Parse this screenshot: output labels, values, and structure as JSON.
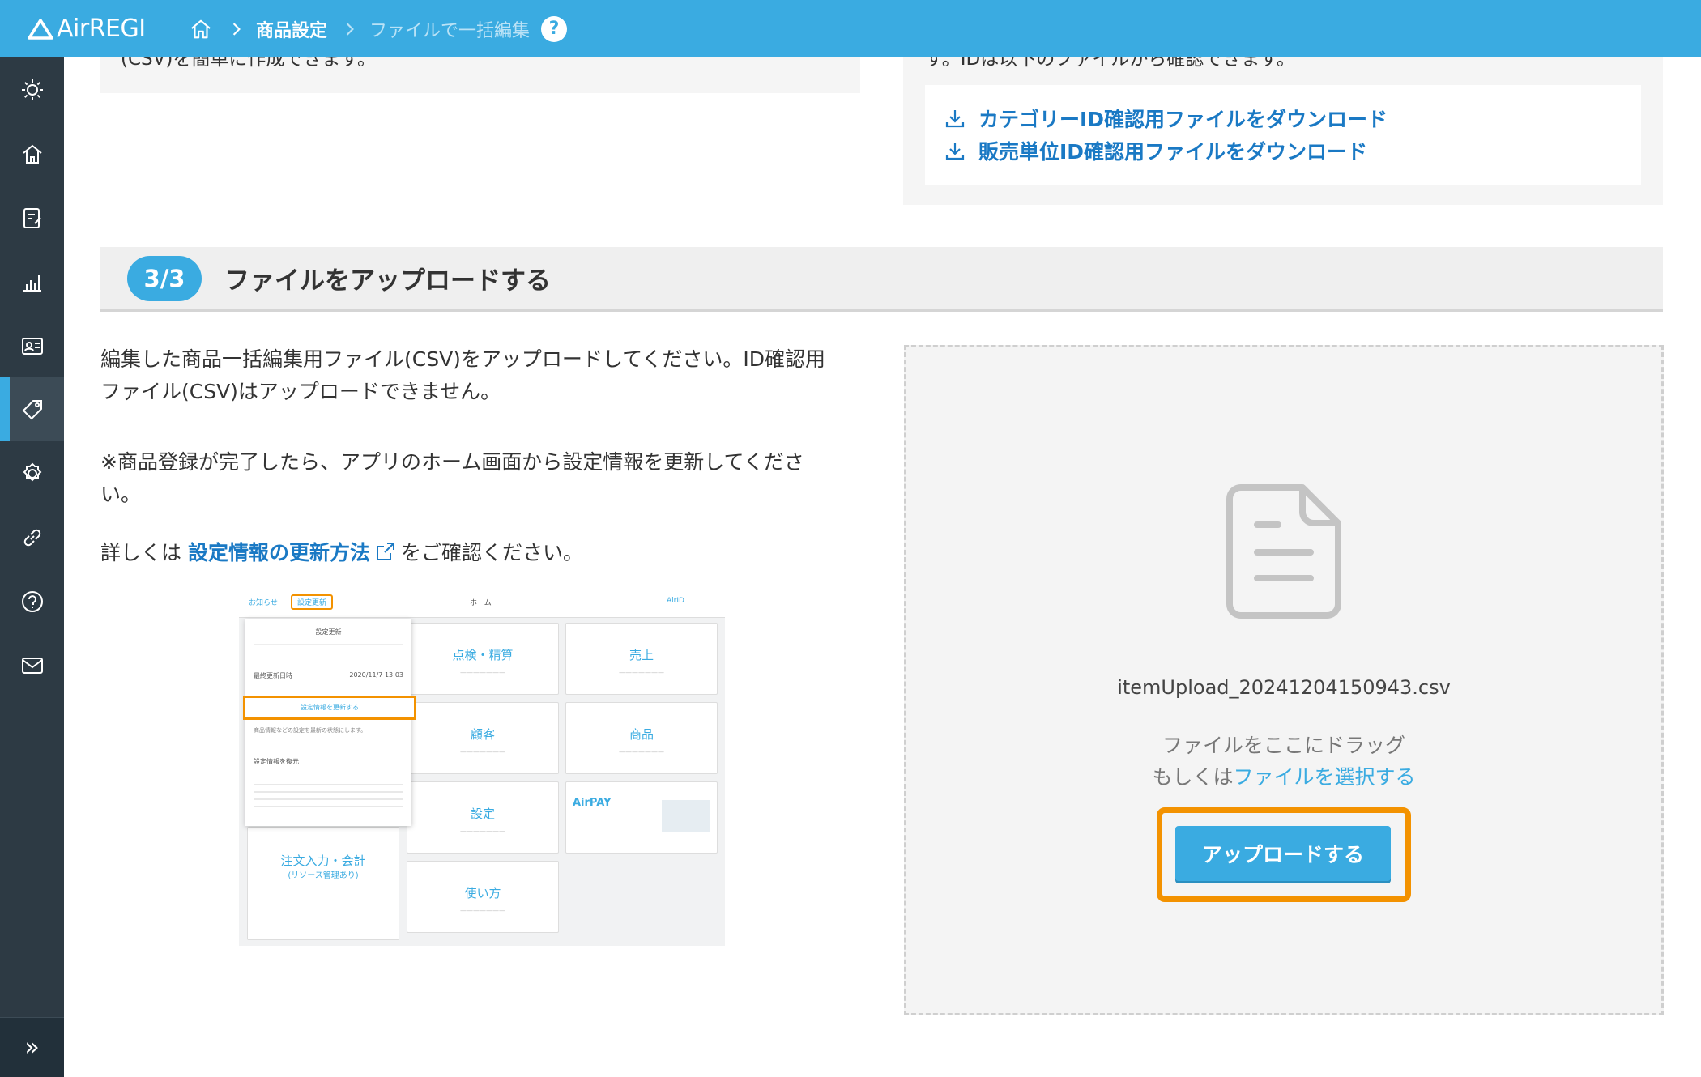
{
  "header": {
    "logo_text": "AirREGI",
    "breadcrumb_link": "商品設定",
    "breadcrumb_current": "ファイルで一括編集",
    "help_glyph": "?"
  },
  "sidebar": {
    "items": [
      "sun-icon",
      "home-icon",
      "order-icon",
      "chart-icon",
      "customer-icon",
      "tag-icon",
      "settings-icon",
      "link-icon",
      "help-icon",
      "mail-icon"
    ],
    "active_index": 5,
    "expand_glyph": "»"
  },
  "prev_section": {
    "left_cut_text": "(CSV)を簡単に作成できます。",
    "right_cut_text": "す。IDは以下のファイルから確認できます。",
    "download_links": [
      "カテゴリーID確認用ファイルをダウンロード",
      "販売単位ID確認用ファイルをダウンロード"
    ]
  },
  "section": {
    "step": "3/3",
    "title": "ファイルをアップロードする",
    "para1_line1": "編集した商品一括編集用ファイル(CSV)をアップロードしてください。ID確認用",
    "para1_line2": "ファイル(CSV)はアップロードできません。",
    "para2_line1": "※商品登録が完了したら、アプリのホーム画面から設定情報を更新してくださ",
    "para2_line2": "い。",
    "para3_prefix": "詳しくは",
    "para3_link": "設定情報の更新方法",
    "para3_suffix": "をご確認ください。"
  },
  "thumbnail": {
    "tab_news": "お知らせ",
    "tab_update": "設定更新",
    "title": "ホーム",
    "account": "AirID",
    "popup_title": "設定更新",
    "popup_last_update_label": "最終更新日時",
    "popup_last_update_value": "2020/11/7 13:03",
    "popup_button": "設定情報を更新する",
    "popup_note": "商品情報などの設定を最新の状態にします。",
    "popup_restore": "設定情報を復元",
    "cards": [
      "点検・精算",
      "売上",
      "顧客",
      "商品",
      "設定",
      "使い方"
    ],
    "card_order": "注文入力・会計",
    "card_order_sub": "(リソース管理あり)",
    "promo": "AirPAY"
  },
  "dropzone": {
    "file_name": "itemUpload_20241204150943.csv",
    "drag_text": "ファイルをここにドラッグ",
    "or_text": "もしくは",
    "select_link": "ファイルを選択する",
    "upload_button": "アップロードする"
  },
  "colors": {
    "brand": "#3aabe1",
    "sidebar": "#2d3a44",
    "highlight": "#f39200",
    "link": "#1a79c4"
  }
}
